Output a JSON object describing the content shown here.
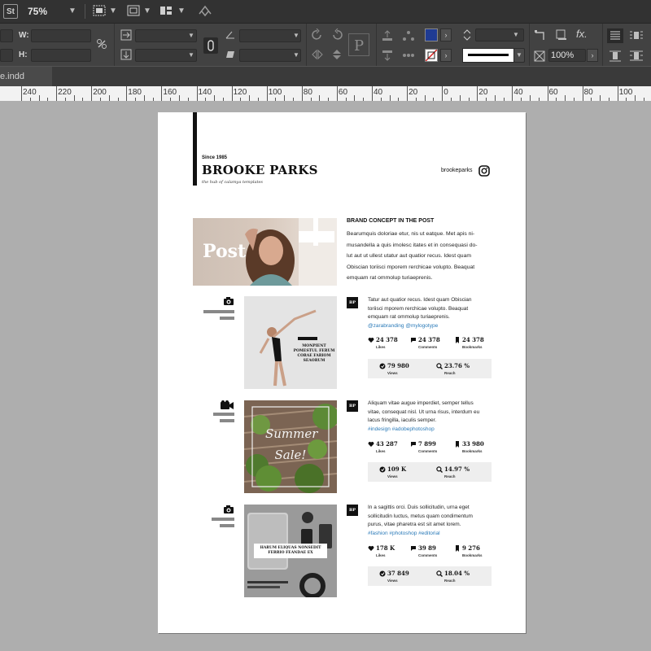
{
  "app": {
    "logo": "St",
    "zoom": "75%",
    "doc_tab": "e.indd"
  },
  "control_panel": {
    "w_label": "W:",
    "h_label": "H:",
    "scale_value": "100%"
  },
  "ruler": {
    "labels": [
      "240",
      "220",
      "200",
      "180",
      "160",
      "140",
      "120",
      "100",
      "80",
      "60",
      "40",
      "20",
      "0",
      "20",
      "40",
      "60",
      "80",
      "100"
    ]
  },
  "document": {
    "since": "Since 1985",
    "name": "BROOKE PARKS",
    "tagline": "the hub of calamya templates",
    "handle": "brookeparks",
    "hero_overlay": "Post",
    "concept_title": "BRAND CONCEPT IN THE POST",
    "concept_lines": [
      "Bearumquis doloriae etur, nis ut eatque. Met apis ni-",
      "musandella a quis imolesc itates et in consequasi do-",
      "lut aut ut ullest utatur aut quatior recus. Idest quam",
      "Obiscian toriisci mporem rerchicae volupto. Beaquat",
      "emquam rat ommolup turiaeprenis."
    ],
    "posts": [
      {
        "badge": "BP",
        "media_icon": "camera-icon",
        "image_caption": "MonPient pomestui. Ferum corae fariom seaorum",
        "caption_lines": [
          "Tatur aut quatior recus. Idest quam Obiscian",
          "toriisci mporem rerchicae volupto. Beaquat",
          "emquam rat ommolup turiaeprenis."
        ],
        "tags": "@zarabranding @mylogotype",
        "likes": "24 378",
        "comments": "24 378",
        "bookmarks": "24 378",
        "views": "79 980",
        "reach": "23.76 %"
      },
      {
        "badge": "BP",
        "media_icon": "video-camera-icon",
        "image_caption": "Summer Sale!",
        "caption_lines": [
          "Aliquam vitae augue imperdiet, semper tellus",
          "vitae, consequat nisl. Ut urna risus, interdum eu",
          "lacus fringilla, iaculis semper."
        ],
        "tags": "#indesign #adobephotoshop",
        "likes": "43 287",
        "comments": "7 899",
        "bookmarks": "33 980",
        "views": "109 K",
        "reach": "14.97 %"
      },
      {
        "badge": "BP",
        "media_icon": "camera-icon",
        "image_caption": "Harum eliquas nonsedit ferrio feandae ex",
        "caption_lines": [
          "In a sagittis orci. Duis sollicitudin, urna eget",
          "sollicitudin luctus, metus quam condimentum",
          "purus, vitae pharetra est sit amet lorem."
        ],
        "tags": "#fashion #photoshop #editorial",
        "likes": "178 K",
        "comments": "39 89",
        "bookmarks": "9 276",
        "views": "37 849",
        "reach": "18.04 %"
      }
    ],
    "stat_labels": {
      "likes": "Likes",
      "comments": "Comments",
      "bookmarks": "Bookmarks",
      "views": "Views",
      "reach": "Reach"
    }
  }
}
